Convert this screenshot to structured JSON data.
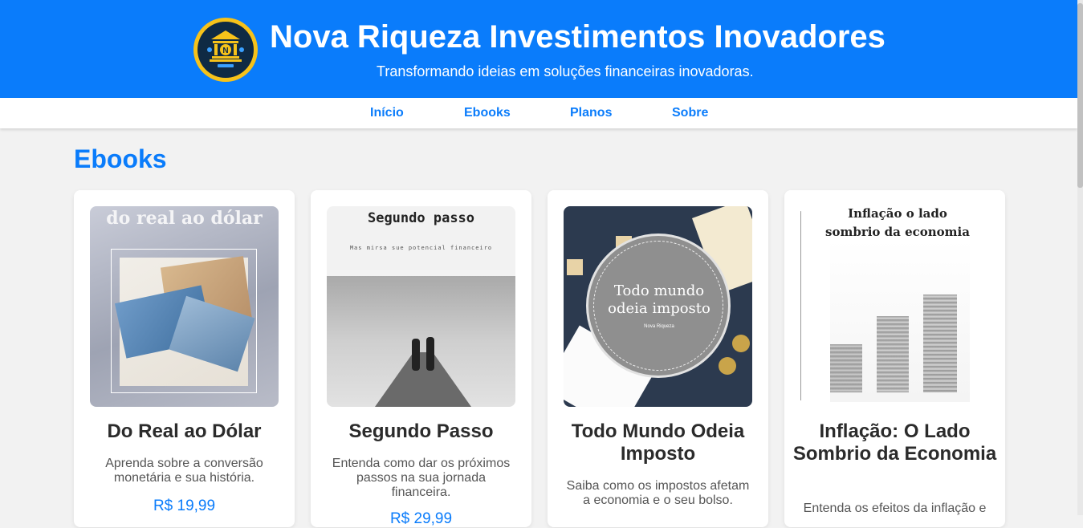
{
  "header": {
    "title": "Nova Riqueza Investimentos Inovadores",
    "tagline": "Transformando ideias em soluções financeiras inovadoras.",
    "logo_icon": "bank-logo-icon"
  },
  "nav": {
    "items": [
      {
        "label": "Início"
      },
      {
        "label": "Ebooks"
      },
      {
        "label": "Planos"
      },
      {
        "label": "Sobre"
      }
    ]
  },
  "main": {
    "section_title": "Ebooks",
    "ebooks": [
      {
        "cover_text": "do real ao dólar",
        "title": "Do Real ao Dólar",
        "description": "Aprenda sobre a conversão monetária e sua história.",
        "price": "R$ 19,99"
      },
      {
        "cover_text": "Segundo passo",
        "cover_subtext": "Mas mirsa sue potencial financeiro",
        "title": "Segundo Passo",
        "description": "Entenda como dar os próximos passos na sua jornada financeira.",
        "price": "R$ 29,99"
      },
      {
        "cover_text": "Todo mundo odeia imposto",
        "cover_subtext": "Nova Riqueza",
        "title": "Todo Mundo Odeia Imposto",
        "description": "Saiba como os impostos afetam a economia e o seu bolso."
      },
      {
        "cover_text": "Inflação o lado sombrio da economia",
        "title": "Inflação: O Lado Sombrio da Economia",
        "description": "Entenda os efeitos da inflação e"
      }
    ]
  },
  "colors": {
    "primary": "#0a7cfb",
    "background": "#f2f2f2",
    "logo_gold": "#f6c21a",
    "logo_navy": "#0f2a44"
  }
}
